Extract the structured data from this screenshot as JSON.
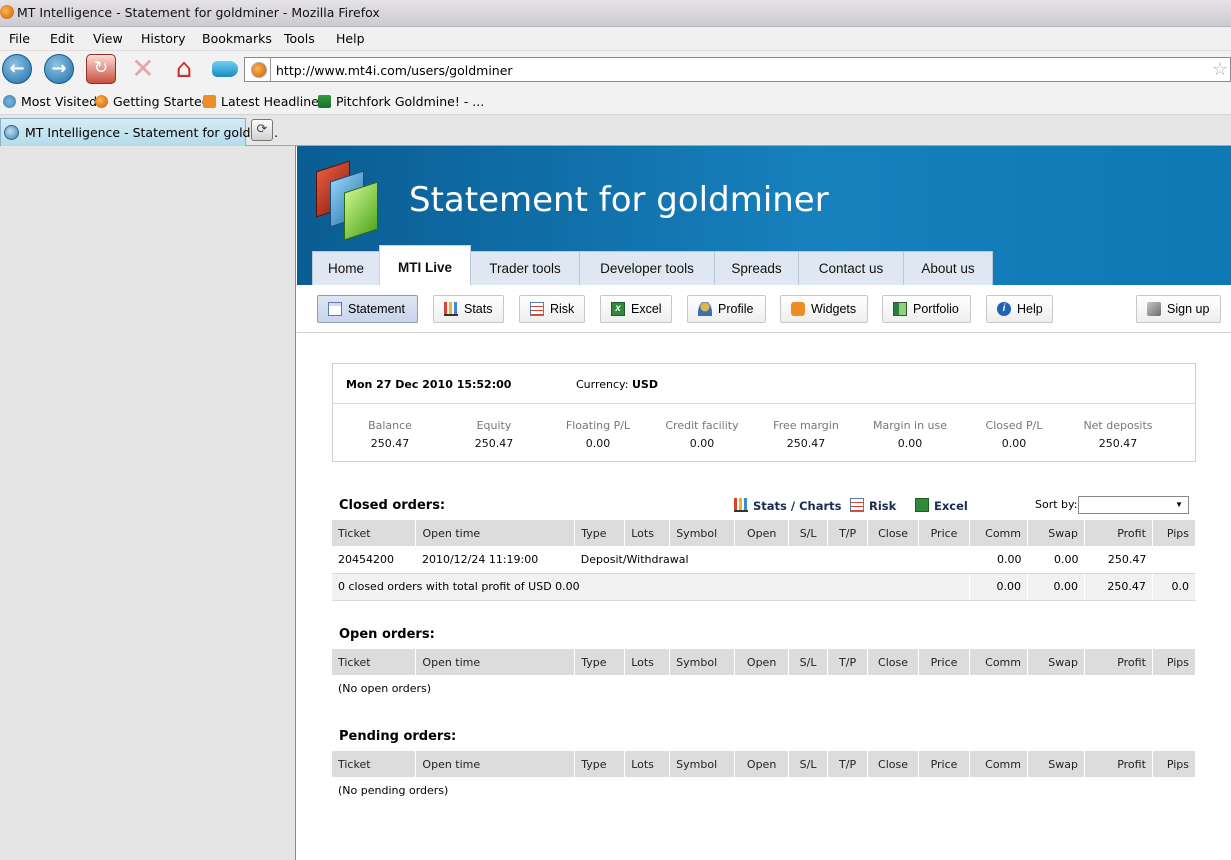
{
  "window": {
    "title": "MT Intelligence - Statement for goldminer - Mozilla Firefox"
  },
  "menu": [
    "File",
    "Edit",
    "View",
    "History",
    "Bookmarks",
    "Tools",
    "Help"
  ],
  "url": "http://www.mt4i.com/users/goldminer",
  "bookmarks": [
    "Most Visited",
    "Getting Started",
    "Latest Headlines",
    "Pitchfork Goldmine! - ..."
  ],
  "tab": {
    "title": "MT Intelligence - Statement for goldmi..."
  },
  "site": {
    "heading": "Statement for goldminer",
    "tabs": [
      "Home",
      "MTI Live",
      "Trader tools",
      "Developer tools",
      "Spreads",
      "Contact us",
      "About us"
    ],
    "active_tab": "MTI Live",
    "subnav": [
      "Statement",
      "Stats",
      "Risk",
      "Excel",
      "Profile",
      "Widgets",
      "Portfolio",
      "Help",
      "Sign up"
    ],
    "active_subnav": "Statement"
  },
  "summary": {
    "datetime": "Mon 27 Dec 2010 15:52:00",
    "currency_label": "Currency:",
    "currency": "USD",
    "metrics": [
      {
        "label": "Balance",
        "value": "250.47"
      },
      {
        "label": "Equity",
        "value": "250.47"
      },
      {
        "label": "Floating P/L",
        "value": "0.00"
      },
      {
        "label": "Credit facility",
        "value": "0.00"
      },
      {
        "label": "Free margin",
        "value": "250.47"
      },
      {
        "label": "Margin in use",
        "value": "0.00"
      },
      {
        "label": "Closed P/L",
        "value": "0.00"
      },
      {
        "label": "Net deposits",
        "value": "250.47"
      }
    ]
  },
  "columns": [
    "Ticket",
    "Open time",
    "Type",
    "Lots",
    "Symbol",
    "Open",
    "S/L",
    "T/P",
    "Close",
    "Price",
    "Comm",
    "Swap",
    "Profit",
    "Pips"
  ],
  "closed": {
    "title": "Closed orders:",
    "tools": {
      "stats": "Stats / Charts",
      "risk": "Risk",
      "excel": "Excel",
      "sort_label": "Sort by:"
    },
    "row": {
      "ticket": "20454200",
      "time": "2010/12/24 11:19:00",
      "type": "Deposit/Withdrawal",
      "comm": "0.00",
      "swap": "0.00",
      "profit": "250.47",
      "pips": ""
    },
    "total": {
      "text": "0 closed orders with total profit of USD 0.00",
      "comm": "0.00",
      "swap": "0.00",
      "profit": "250.47",
      "pips": "0.0"
    }
  },
  "open": {
    "title": "Open orders:",
    "empty": "(No open orders)"
  },
  "pending": {
    "title": "Pending orders:",
    "empty": "(No pending orders)"
  }
}
